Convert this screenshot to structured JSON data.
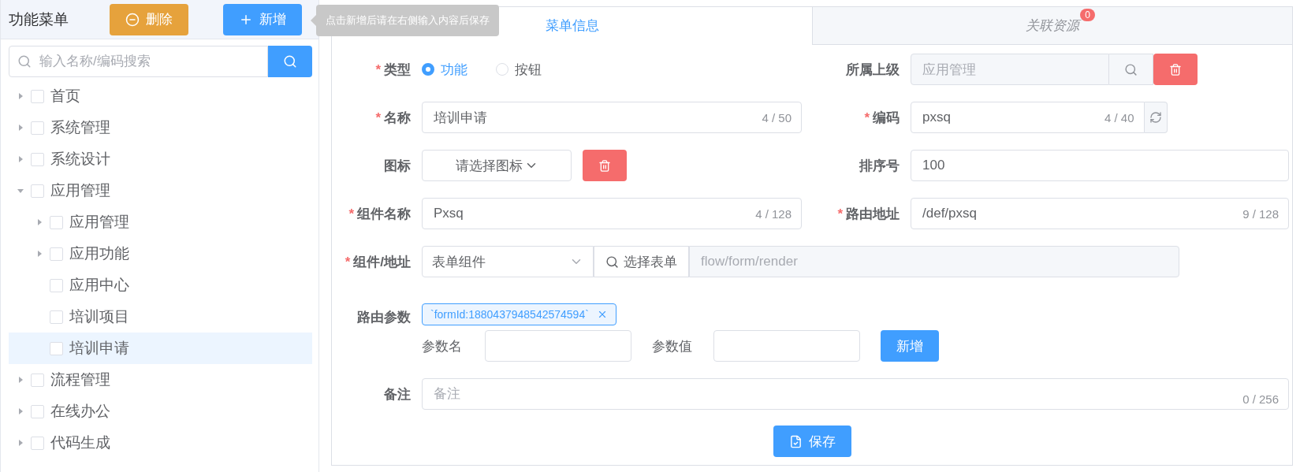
{
  "sidebar": {
    "title": "功能菜单",
    "delete_button": "删除",
    "add_button": "新增",
    "tooltip": "点击新增后请在右侧输入内容后保存",
    "search": {
      "placeholder": "输入名称/编码搜索"
    },
    "tree": [
      {
        "label": "首页",
        "expandable": true,
        "expanded": false,
        "checked": false,
        "selected": false
      },
      {
        "label": "系统管理",
        "expandable": true,
        "expanded": false,
        "checked": false,
        "selected": false
      },
      {
        "label": "系统设计",
        "expandable": true,
        "expanded": false,
        "checked": false,
        "selected": false
      },
      {
        "label": "应用管理",
        "expandable": true,
        "expanded": true,
        "checked": false,
        "selected": false,
        "children": [
          {
            "label": "应用管理",
            "expandable": true,
            "expanded": false,
            "checked": false,
            "selected": false
          },
          {
            "label": "应用功能",
            "expandable": true,
            "expanded": false,
            "checked": false,
            "selected": false
          },
          {
            "label": "应用中心",
            "expandable": false,
            "expanded": false,
            "checked": false,
            "selected": false
          },
          {
            "label": "培训项目",
            "expandable": false,
            "expanded": false,
            "checked": false,
            "selected": false
          },
          {
            "label": "培训申请",
            "expandable": false,
            "expanded": false,
            "checked": false,
            "selected": true
          }
        ]
      },
      {
        "label": "流程管理",
        "expandable": true,
        "expanded": false,
        "checked": false,
        "selected": false
      },
      {
        "label": "在线办公",
        "expandable": true,
        "expanded": false,
        "checked": false,
        "selected": false
      },
      {
        "label": "代码生成",
        "expandable": true,
        "expanded": false,
        "checked": false,
        "selected": false
      }
    ]
  },
  "tabs": [
    {
      "label": "菜单信息",
      "selected": true
    },
    {
      "label": "关联资源",
      "selected": false,
      "badge": "0"
    }
  ],
  "form": {
    "type": {
      "label": "类型",
      "required": "*",
      "options": [
        {
          "label": "功能",
          "selected": true
        },
        {
          "label": "按钮",
          "selected": false
        }
      ]
    },
    "parent": {
      "label": "所属上级",
      "value": "应用管理",
      "disabled": true
    },
    "name": {
      "label": "名称",
      "required": "*",
      "value": "培训申请",
      "counter": "4 / 50"
    },
    "code": {
      "label": "编码",
      "required": "*",
      "value": "pxsq",
      "counter": "4 / 40"
    },
    "icon": {
      "label": "图标",
      "value": "请选择图标"
    },
    "sort": {
      "label": "排序号",
      "value": "100"
    },
    "component_name": {
      "label": "组件名称",
      "required": "*",
      "value": "Pxsq",
      "counter": "4 / 128"
    },
    "route": {
      "label": "路由地址",
      "required": "*",
      "value": "/def/pxsq",
      "counter": "9 / 128"
    },
    "component": {
      "label": "组件/地址",
      "required": "*",
      "select_value": "表单组件",
      "button": "选择表单",
      "address": "flow/form/render",
      "address_disabled": true
    },
    "route_params": {
      "label": "路由参数",
      "tags": [
        "`formId:1880437948542574594`"
      ],
      "name_label": "参数名",
      "value_label": "参数值",
      "add_button": "新增"
    },
    "remark": {
      "label": "备注",
      "placeholder": "备注",
      "counter": "0 / 256"
    },
    "save_button": "保存"
  }
}
